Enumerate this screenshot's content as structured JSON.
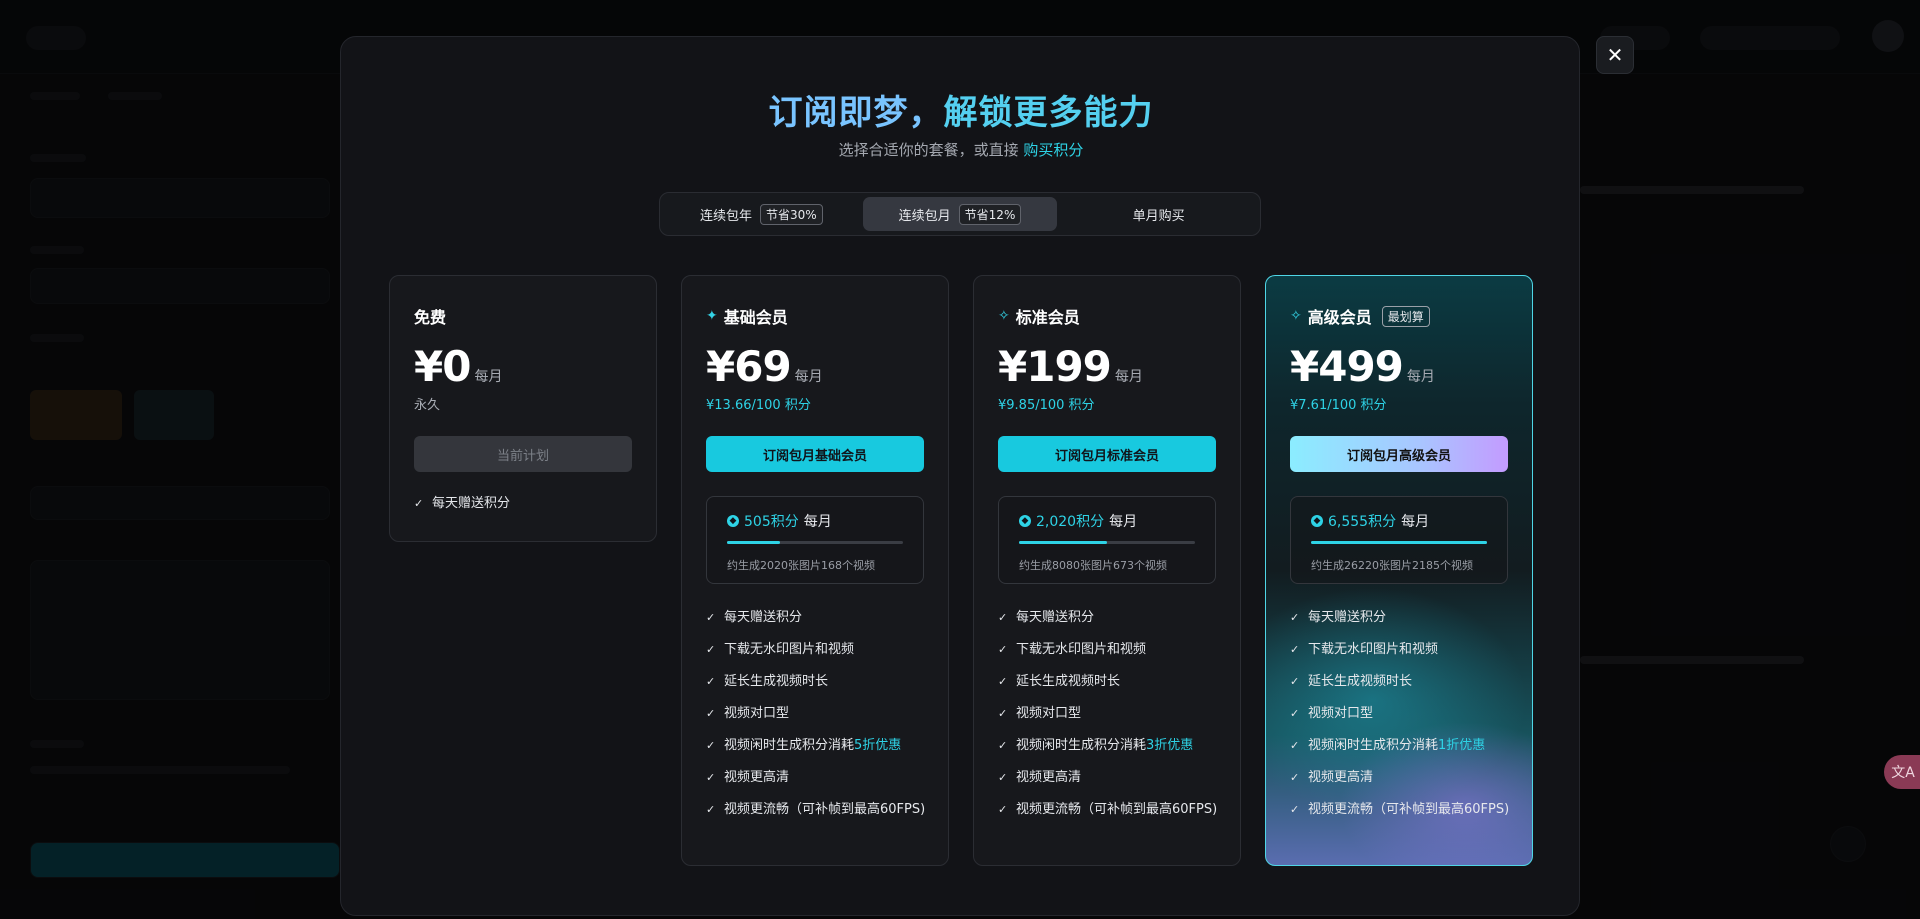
{
  "modal": {
    "title_part1": "订阅即梦，",
    "title_part2": "解锁更多能力",
    "subtitle_prefix": "选择合适你的套餐，或直接",
    "subtitle_link": "购买积分",
    "close_icon": "×"
  },
  "tabs": [
    {
      "label": "连续包年",
      "badge": "节省30%",
      "active": false
    },
    {
      "label": "连续包月",
      "badge": "节省12%",
      "active": true
    },
    {
      "label": "单月购买",
      "badge": "",
      "active": false
    }
  ],
  "plans": {
    "free": {
      "name": "免费",
      "price": "¥0",
      "period": "每月",
      "sub": "永久",
      "cta": "当前计划",
      "features": [
        "每天赠送积分"
      ]
    },
    "basic": {
      "name": "基础会员",
      "price": "¥69",
      "period": "每月",
      "sub": "¥13.66/100 积分",
      "cta": "订阅包月基础会员",
      "credits": "505积分",
      "credits_unit": "每月",
      "credits_fraction": 0.3,
      "credits_note": "约生成2020张图片168个视频",
      "features": [
        "每天赠送积分",
        "下载无水印图片和视频",
        "延长生成视频时长",
        "视频对口型"
      ],
      "discount_prefix": "视频闲时生成积分消耗",
      "discount_hl": "5折优惠",
      "features_after": [
        "视频更高清",
        "视频更流畅（可补帧到最高60FPS)"
      ]
    },
    "standard": {
      "name": "标准会员",
      "price": "¥199",
      "period": "每月",
      "sub": "¥9.85/100 积分",
      "cta": "订阅包月标准会员",
      "credits": "2,020积分",
      "credits_unit": "每月",
      "credits_fraction": 0.5,
      "credits_note": "约生成8080张图片673个视频",
      "features": [
        "每天赠送积分",
        "下载无水印图片和视频",
        "延长生成视频时长",
        "视频对口型"
      ],
      "discount_prefix": "视频闲时生成积分消耗",
      "discount_hl": "3折优惠",
      "features_after": [
        "视频更高清",
        "视频更流畅（可补帧到最高60FPS)"
      ]
    },
    "premium": {
      "name": "高级会员",
      "tag": "最划算",
      "price": "¥499",
      "period": "每月",
      "sub": "¥7.61/100 积分",
      "cta": "订阅包月高级会员",
      "credits": "6,555积分",
      "credits_unit": "每月",
      "credits_fraction": 1.0,
      "credits_note": "约生成26220张图片2185个视频",
      "features": [
        "每天赠送积分",
        "下载无水印图片和视频",
        "延长生成视频时长",
        "视频对口型"
      ],
      "discount_prefix": "视频闲时生成积分消耗",
      "discount_hl": "1折优惠",
      "features_after": [
        "视频更高清",
        "视频更流畅（可补帧到最高60FPS)"
      ]
    }
  },
  "colors": {
    "accent": "#2ed3e6",
    "title_blue": "#79c4ff",
    "premium_border": "#4fd6e6"
  },
  "icons": {
    "close": "close-icon",
    "sparkle": "sparkle-icon",
    "check": "check-icon",
    "coin": "coin-icon",
    "translate": "translate-icon"
  },
  "floating": {
    "translate_glyph": "文A"
  }
}
